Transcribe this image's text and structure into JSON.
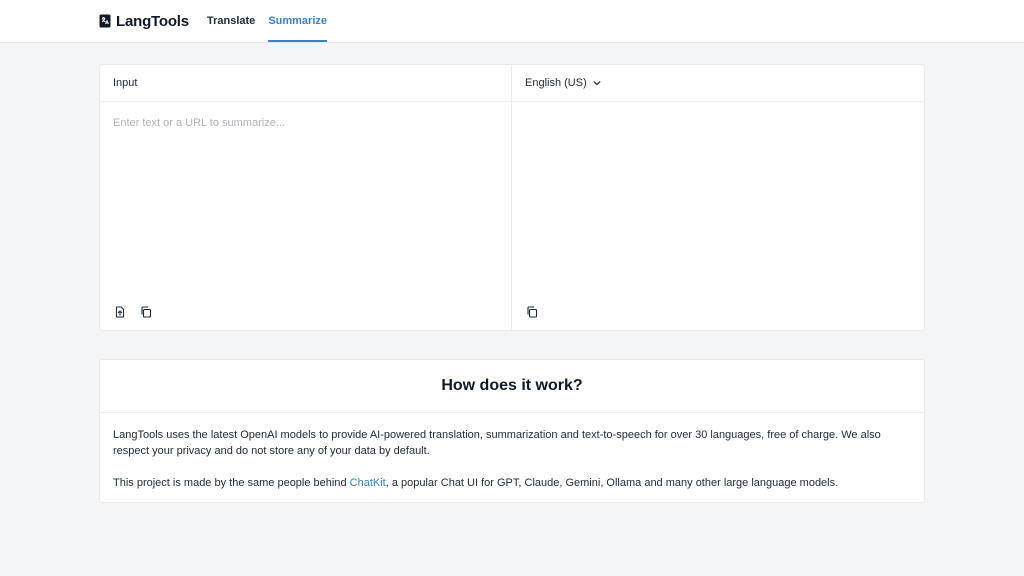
{
  "app": {
    "name": "LangTools",
    "logo_icon": "book-icon"
  },
  "nav": {
    "tabs": [
      {
        "label": "Translate",
        "active": false
      },
      {
        "label": "Summarize",
        "active": true
      }
    ]
  },
  "editor": {
    "input_header": "Input",
    "input_placeholder": "Enter text or a URL to summarize...",
    "input_value": "",
    "output_language": "English (US)",
    "input_tools": [
      "file-upload-icon",
      "copy-icon"
    ],
    "output_tools": [
      "copy-icon"
    ]
  },
  "info": {
    "title": "How does it work?",
    "paragraph1": "LangTools uses the latest OpenAI models to provide AI-powered translation, summarization and text-to-speech for over 30 languages, free of charge. We also respect your privacy and do not store any of your data by default.",
    "paragraph2_before": "This project is made by the same people behind ",
    "paragraph2_link": "ChatKit",
    "paragraph2_after": ", a popular Chat UI for GPT, Claude, Gemini, Ollama and many other large language models."
  },
  "colors": {
    "accent": "#3b82c4",
    "background": "#f4f5f7",
    "card": "#ffffff",
    "border": "#e9eaee"
  }
}
